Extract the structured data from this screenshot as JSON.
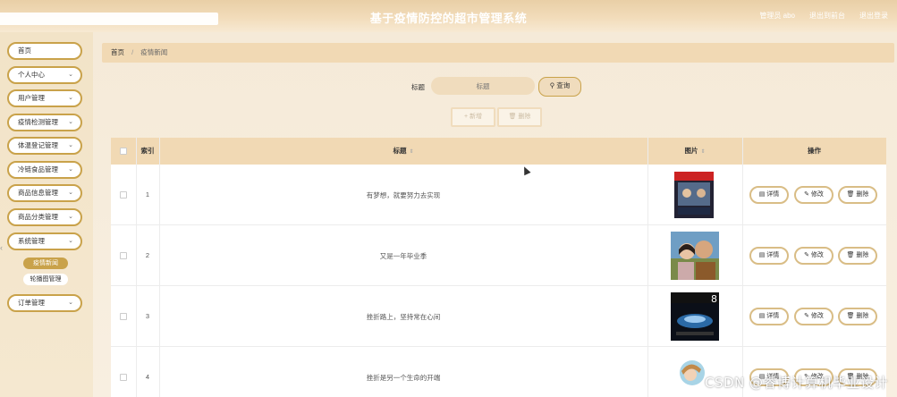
{
  "header": {
    "title": "基于疫情防控的超市管理系统",
    "links": [
      "管理员 abo",
      "退出到前台",
      "退出登录"
    ]
  },
  "sidebar": {
    "items": [
      {
        "label": "首页"
      },
      {
        "label": "个人中心"
      },
      {
        "label": "用户管理"
      },
      {
        "label": "疫情检测管理"
      },
      {
        "label": "体温登记管理"
      },
      {
        "label": "冷链食品管理"
      },
      {
        "label": "商品信息管理"
      },
      {
        "label": "商品分类管理"
      },
      {
        "label": "系统管理"
      },
      {
        "label": "订单管理"
      }
    ],
    "system_subitems": [
      {
        "label": "疫情新闻",
        "active": true
      },
      {
        "label": "轮播图管理",
        "active": false
      }
    ],
    "chevron": "⌄"
  },
  "breadcrumb": {
    "home": "首页",
    "current": "疫情新闻",
    "separator": "/"
  },
  "search": {
    "label": "标题",
    "placeholder": "标题",
    "button": "查询"
  },
  "actions": {
    "add": "新增",
    "delete": "删除"
  },
  "table": {
    "columns": [
      "索引",
      "标题",
      "图片",
      "操作"
    ],
    "rows": [
      {
        "index": "1",
        "title": "有梦想，就要努力去实现",
        "image": "magazine-cover"
      },
      {
        "index": "2",
        "title": "又是一年毕业季",
        "image": "family-selfie"
      },
      {
        "index": "3",
        "title": "挫折路上，坚持常在心间",
        "image": "book-cover"
      },
      {
        "index": "4",
        "title": "挫折是另一个生命的开端",
        "image": "cartoon-illustration"
      }
    ],
    "op_buttons": [
      "详情",
      "修改",
      "删除"
    ]
  },
  "watermark": "CSDN @睿博计算机毕业设计",
  "colors": {
    "accent": "#c9a24a",
    "header_bg": "#f1d9b4",
    "page_bg": "#f5ead8"
  }
}
